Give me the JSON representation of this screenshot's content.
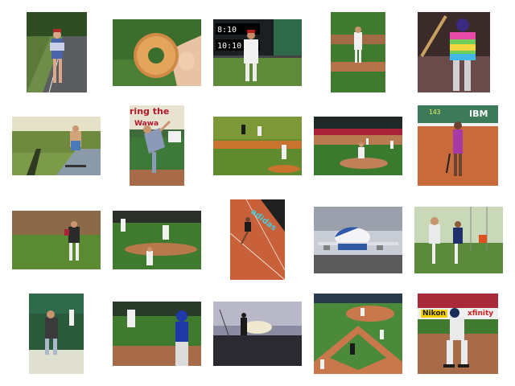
{
  "gallery": {
    "thumbnails": [
      {
        "subject": "person walking on road"
      },
      {
        "subject": "hand holding glazed donut"
      },
      {
        "subject": "baseball pitcher near scoreboard",
        "scoreboard_lines": [
          "8:10",
          "10:10"
        ]
      },
      {
        "subject": "pitcher on mound"
      },
      {
        "subject": "batter in colorful jersey"
      },
      {
        "subject": "skateboarder on path"
      },
      {
        "subject": "pitcher throwing"
      },
      {
        "subject": "baseball field wide view"
      },
      {
        "subject": "baseball infield play"
      },
      {
        "subject": "tennis player on clay court",
        "sign_text": "IBM"
      },
      {
        "subject": "pitcher on mound"
      },
      {
        "subject": "infield players"
      },
      {
        "subject": "tennis player serving",
        "sign_text": "adidas"
      },
      {
        "subject": "jumbo jet on runway"
      },
      {
        "subject": "two baseball players"
      },
      {
        "subject": "batter at plate"
      },
      {
        "subject": "batter and catcher"
      },
      {
        "subject": "skateboarder at dusk"
      },
      {
        "subject": "baseball field aerial"
      },
      {
        "subject": "batter stance",
        "sign_texts": [
          "Nikon",
          "xfinity"
        ]
      }
    ]
  }
}
